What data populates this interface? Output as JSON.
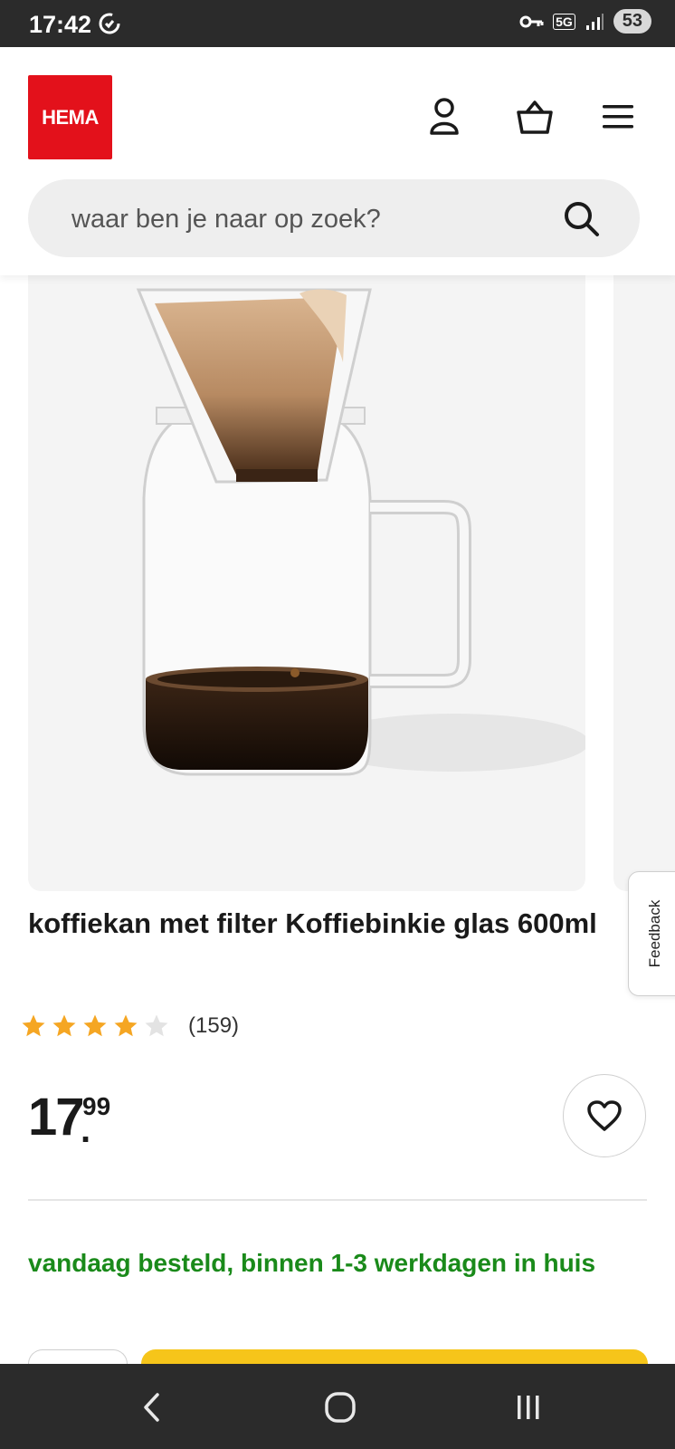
{
  "status_bar": {
    "time": "17:42",
    "network": "5G",
    "battery": "53"
  },
  "header": {
    "logo_text": "HEMA"
  },
  "search": {
    "placeholder": "waar ben je naar op zoek?"
  },
  "feedback": {
    "label": "Feedback"
  },
  "product": {
    "title": "koffiekan met filter Koffiebinkie glas 600ml",
    "rating": 4,
    "rating_max": 5,
    "review_count": "(159)",
    "price_euros": "17",
    "price_cents": "99",
    "delivery": "vandaag besteld, binnen 1-3 werkdagen in huis"
  },
  "colors": {
    "brand": "#e3111b",
    "delivery_green": "#1a8a1a",
    "cta_yellow": "#f6c51a",
    "star": "#f5a623"
  }
}
